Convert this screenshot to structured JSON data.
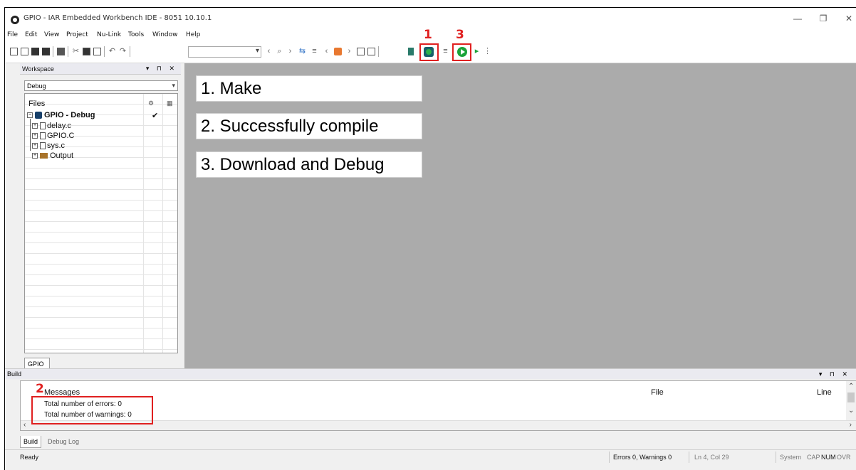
{
  "window": {
    "title": "GPIO - IAR Embedded Workbench IDE - 8051 10.10.1",
    "minimize_glyph": "—",
    "restore_glyph": "❐",
    "close_glyph": "✕"
  },
  "menu": [
    "File",
    "Edit",
    "View",
    "Project",
    "Nu-Link",
    "Tools",
    "Window",
    "Help"
  ],
  "toolbar": {
    "search_value": "",
    "annotations": {
      "make_number": "1",
      "debug_number": "3"
    },
    "icons": [
      "new-file-icon",
      "open-file-icon",
      "save-icon",
      "save-all-icon",
      "print-icon",
      "cut-icon",
      "copy-icon",
      "paste-icon",
      "undo-icon",
      "redo-icon",
      "find-prev-icon",
      "find-icon",
      "find-next-icon",
      "bookmark-icon",
      "make-icon",
      "build-options-icon",
      "download-debug-icon",
      "debug-without-download-icon"
    ]
  },
  "workspace": {
    "title": "Workspace",
    "controls": "▾ ⊓ ✕",
    "configuration": "Debug",
    "tree_header": "Files",
    "project": "GPIO - Debug",
    "project_check": "✔",
    "files": [
      "delay.c",
      "GPIO.C",
      "sys.c"
    ],
    "folder": "Output",
    "tab": "GPIO"
  },
  "callouts": [
    "1. Make",
    "2. Successfully compile",
    "3. Download and Debug"
  ],
  "build": {
    "title": "Build",
    "controls": "▾ ⊓ ✕",
    "annotation_number": "2",
    "columns": {
      "messages": "Messages",
      "file": "File",
      "line": "Line"
    },
    "rows": [
      "Total number of errors: 0",
      "Total number of warnings: 0"
    ],
    "tabs": [
      "Build",
      "Debug Log"
    ]
  },
  "status": {
    "ready": "Ready",
    "errors_warnings": "Errors 0, Warnings 0",
    "position": "Ln 4, Col 29",
    "system": "System",
    "cap": "CAP",
    "num": "NUM",
    "ovr": "OVR"
  },
  "colors": {
    "highlight": "#e02020",
    "editor_bg": "#ababab"
  }
}
